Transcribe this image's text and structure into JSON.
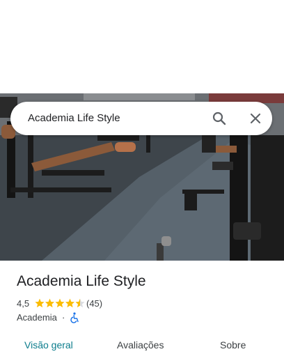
{
  "search": {
    "query": "Academia Life Style"
  },
  "place": {
    "name": "Academia Life Style",
    "rating": "4,5",
    "stars": 4.5,
    "review_count": "(45)",
    "category": "Academia",
    "separator": "·"
  },
  "tabs": [
    {
      "label": "Visão geral",
      "active": true
    },
    {
      "label": "Avaliações",
      "active": false
    },
    {
      "label": "Sobre",
      "active": false
    }
  ],
  "colors": {
    "accent": "#0b7c8c",
    "star": "#fbbc04",
    "accessibility": "#1a73e8"
  }
}
